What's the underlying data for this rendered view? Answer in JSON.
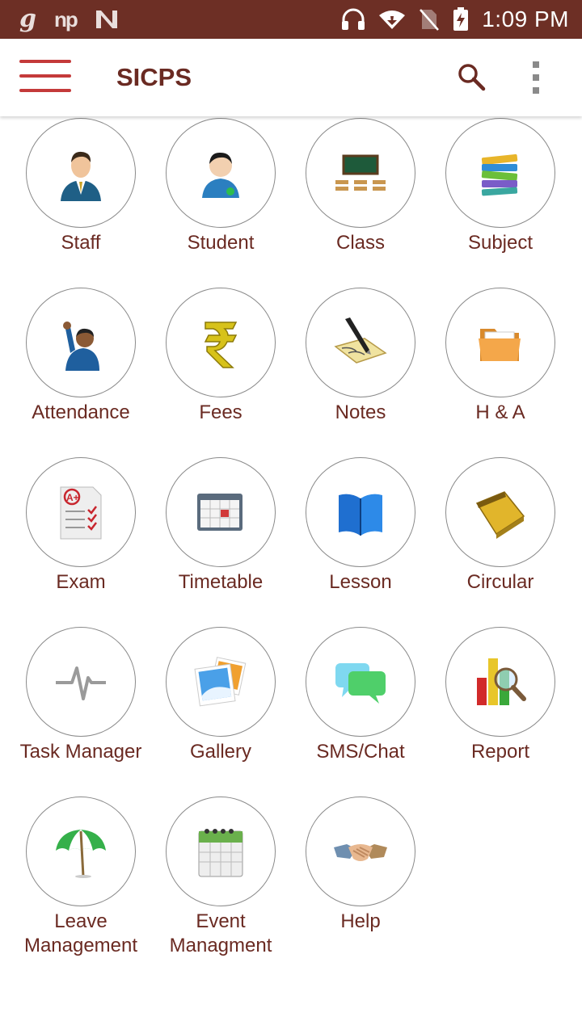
{
  "status_bar": {
    "time": "1:09 PM",
    "left_icons": [
      "g-icon",
      "np-icon",
      "n-notification-icon"
    ],
    "right_icons": [
      "headphones-icon",
      "wifi-icon",
      "no-sim-icon",
      "battery-charging-icon"
    ]
  },
  "app_bar": {
    "title": "SICPS",
    "title_color": "#6a2a22",
    "status_bar_color": "#6d2f25",
    "hamburger_color": "#c43a3a"
  },
  "menu": [
    {
      "label": "Staff",
      "icon": "staff-icon"
    },
    {
      "label": "Student",
      "icon": "student-icon"
    },
    {
      "label": "Class",
      "icon": "classroom-icon"
    },
    {
      "label": "Subject",
      "icon": "books-icon"
    },
    {
      "label": "Attendance",
      "icon": "raised-hand-icon"
    },
    {
      "label": "Fees",
      "icon": "rupee-icon"
    },
    {
      "label": "Notes",
      "icon": "pen-notepad-icon"
    },
    {
      "label": "H & A",
      "icon": "folder-icon"
    },
    {
      "label": "Exam",
      "icon": "exam-paper-icon"
    },
    {
      "label": "Timetable",
      "icon": "calendar-icon"
    },
    {
      "label": "Lesson",
      "icon": "open-book-icon"
    },
    {
      "label": "Circular",
      "icon": "notepad-icon"
    },
    {
      "label": "Task Manager",
      "icon": "pulse-icon"
    },
    {
      "label": "Gallery",
      "icon": "photos-icon"
    },
    {
      "label": "SMS/Chat",
      "icon": "chat-bubbles-icon"
    },
    {
      "label": "Report",
      "icon": "report-chart-icon"
    },
    {
      "label": "Leave\nManagement",
      "icon": "umbrella-icon"
    },
    {
      "label": "Event\nManagment",
      "icon": "event-calendar-icon"
    },
    {
      "label": "Help",
      "icon": "handshake-icon"
    }
  ]
}
